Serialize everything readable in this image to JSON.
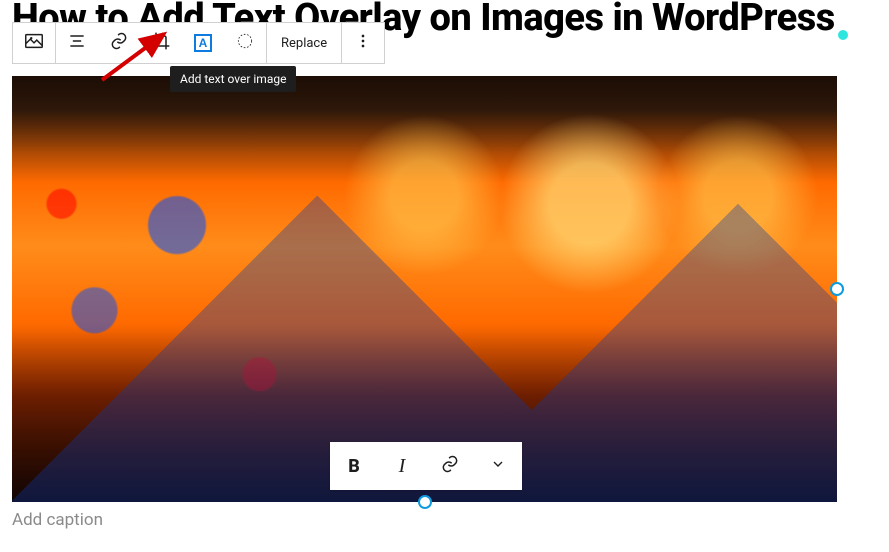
{
  "page": {
    "title": "How to Add Text Overlay on Images in WordPress"
  },
  "toolbar": {
    "replace_label": "Replace",
    "tooltip": "Add text over image",
    "icons": {
      "image": "image-icon",
      "align": "align-icon",
      "link": "link-icon",
      "crop": "crop-icon",
      "text_overlay": "text-overlay-icon",
      "duotone": "duotone-icon",
      "more": "more-icon"
    }
  },
  "format_toolbar": {
    "bold_label": "B",
    "italic_label": "I"
  },
  "caption": {
    "placeholder": "Add caption"
  },
  "colors": {
    "accent": "#0d7be0",
    "handle": "#0d9be0"
  }
}
